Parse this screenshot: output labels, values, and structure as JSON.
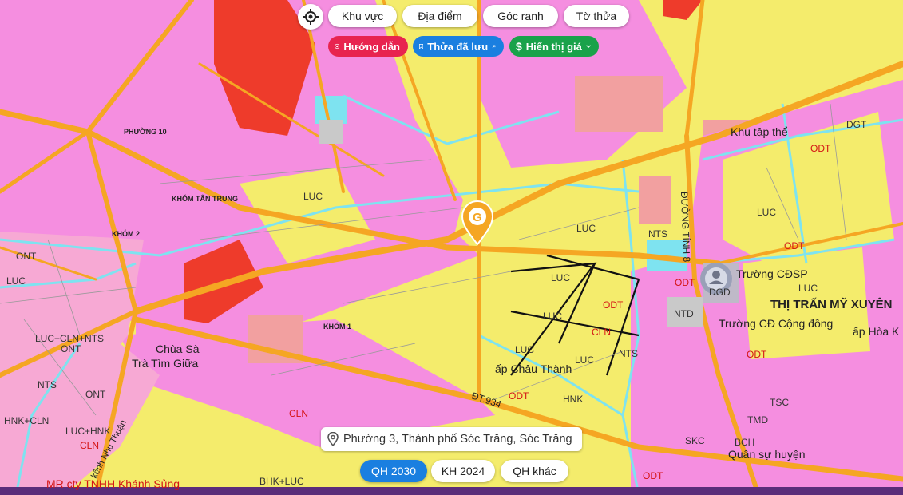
{
  "toolbar": {
    "locate_icon": "crosshair-icon",
    "tabs": [
      "Khu vực",
      "Địa điểm",
      "Góc ranh",
      "Tờ thửa"
    ]
  },
  "actions": {
    "guide_label": "Hướng dẫn",
    "saved_label": "Thửa đã lưu",
    "price_label": "Hiển thị giá",
    "colors": {
      "guide": "#e8244f",
      "saved": "#1a7fe0",
      "price": "#1aa24a"
    }
  },
  "address": {
    "icon": "location-pin-icon",
    "text": "Phường 3, Thành phố Sóc Trăng, Sóc Trăng"
  },
  "plans": {
    "items": [
      "QH 2030",
      "KH 2024",
      "QH khác"
    ],
    "active": "QH 2030",
    "active_color": "#1a7fe0"
  },
  "map": {
    "colors": {
      "luc": "#f4ec6c",
      "odt": "#f58ee0",
      "road": "#f5a623",
      "industrial": "#f2a0a0",
      "red": "#ee3b2b",
      "canal": "#7ee3f0",
      "ont": "#f7a9d4"
    },
    "place_labels": [
      "PHƯỜNG 10",
      "KHÓM TÂN TRUNG",
      "KHÓM 2",
      "KHÓM 1",
      "THỊ TRẤN MỸ XUYÊN",
      "Khu tập thể",
      "Trường CĐSP",
      "Trường CĐ Cộng đồng",
      "ấp Hòa K",
      "ấp Châu Thành",
      "Chùa Sà",
      "Trà Tìm Giữa",
      "Quân sự huyện",
      "MR cty TNHH Khánh Sủng",
      "kênh Nhu Thuận",
      "ĐT.934",
      "ĐƯỜNG TỈNH 8"
    ],
    "zone_codes": [
      "LUC",
      "LUC",
      "LUC",
      "LUC",
      "LUC",
      "LUC",
      "LUC",
      "LUC",
      "LUC",
      "ODT",
      "ODT",
      "ODT",
      "ODT",
      "ODT",
      "ODT",
      "ODT",
      "CLN",
      "CLN",
      "CLN",
      "NTS",
      "NTS",
      "NTS",
      "NTD",
      "ONT",
      "ONT",
      "ONT",
      "DGD",
      "TMD",
      "SKC",
      "HNK",
      "LUC+CLN+NTS",
      "HNK+CLN",
      "LUC+HNK",
      "BHK+LUC",
      "DGT",
      "TSC",
      "BCH"
    ]
  }
}
